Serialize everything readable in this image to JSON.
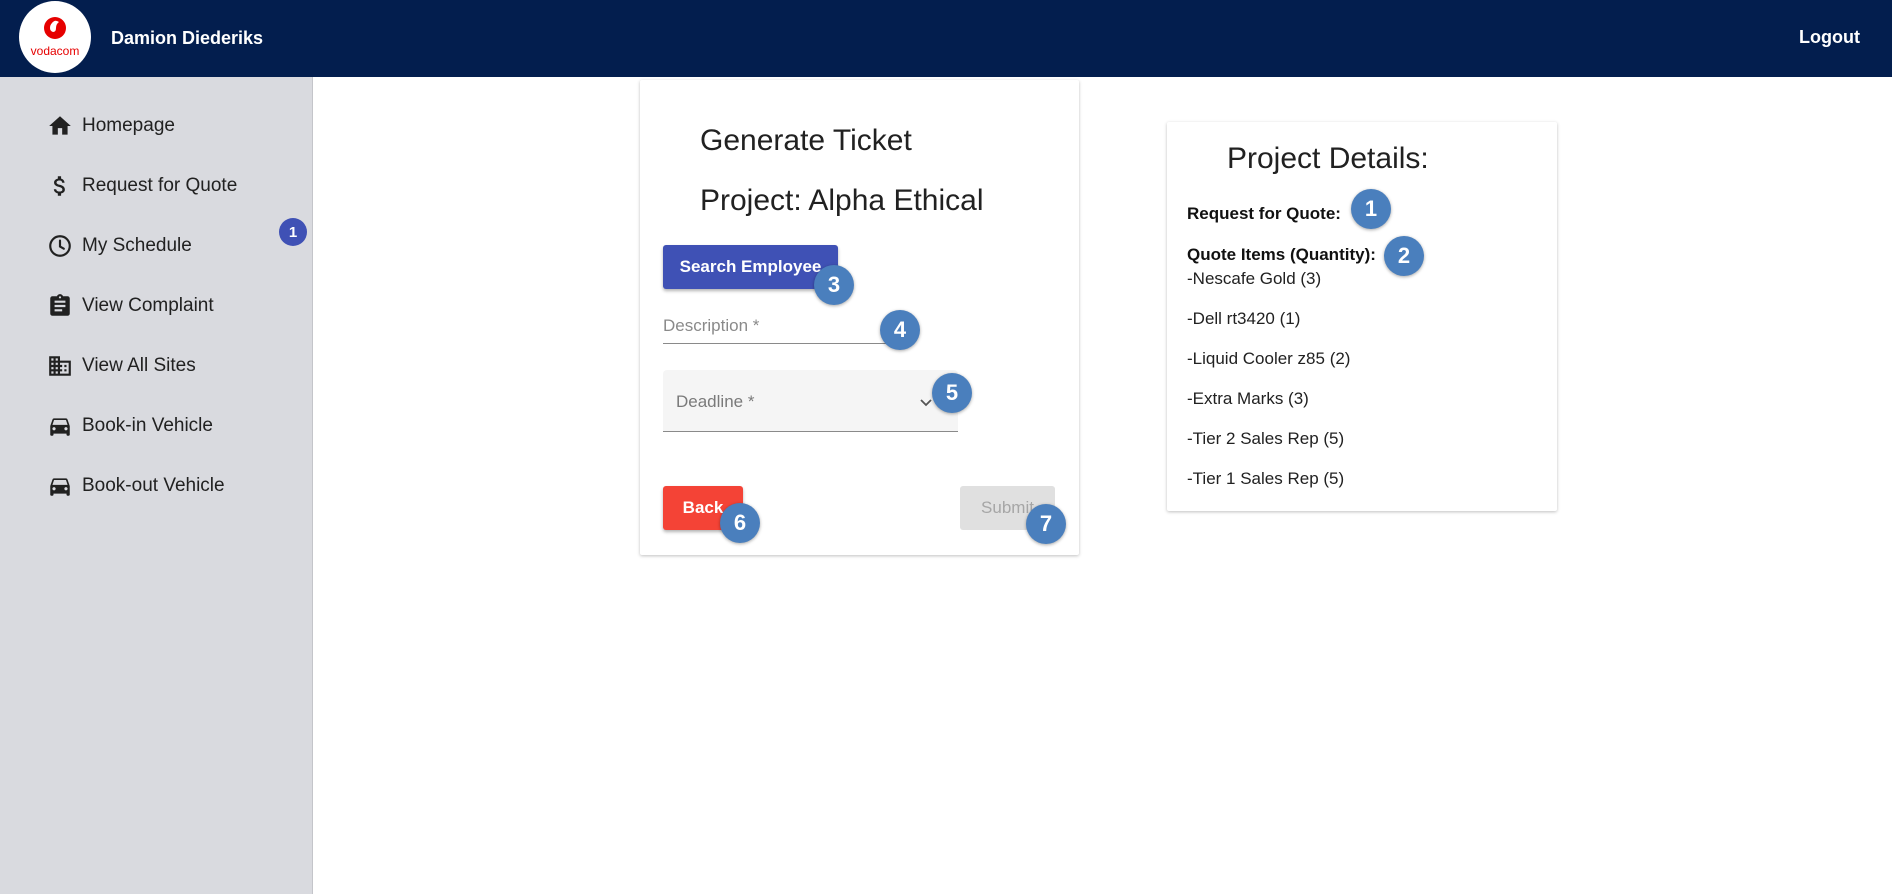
{
  "header": {
    "logo_text": "vodacom",
    "brand_color": "#e60000",
    "bar_color": "#031e4e",
    "username": "Damion Diederiks",
    "logout_label": "Logout"
  },
  "sidebar": {
    "items": [
      {
        "label": "Homepage",
        "icon": "home-icon"
      },
      {
        "label": "Request for Quote",
        "icon": "dollar-icon"
      },
      {
        "label": "My Schedule",
        "icon": "clock-icon"
      },
      {
        "label": "View Complaint",
        "icon": "clipboard-icon"
      },
      {
        "label": "View All Sites",
        "icon": "building-icon"
      },
      {
        "label": "Book-in Vehicle",
        "icon": "car-icon"
      },
      {
        "label": "Book-out Vehicle",
        "icon": "car-icon"
      }
    ],
    "badge": "1"
  },
  "ticket": {
    "title": "Generate Ticket",
    "project": "Project: Alpha Ethical",
    "search_label": "Search Employee",
    "description_placeholder": "Description *",
    "deadline_placeholder": "Deadline *",
    "back_label": "Back",
    "submit_label": "Submit"
  },
  "details": {
    "title": "Project Details:",
    "rfq_label": "Request for Quote:",
    "items_label": "Quote Items (Quantity):",
    "items": [
      "-Nescafe Gold (3)",
      "-Dell rt3420 (1)",
      "-Liquid Cooler z85 (2)",
      "-Extra Marks (3)",
      "-Tier 2 Sales Rep (5)",
      "-Tier 1 Sales Rep (5)"
    ]
  },
  "markers": [
    "1",
    "2",
    "3",
    "4",
    "5",
    "6",
    "7"
  ]
}
